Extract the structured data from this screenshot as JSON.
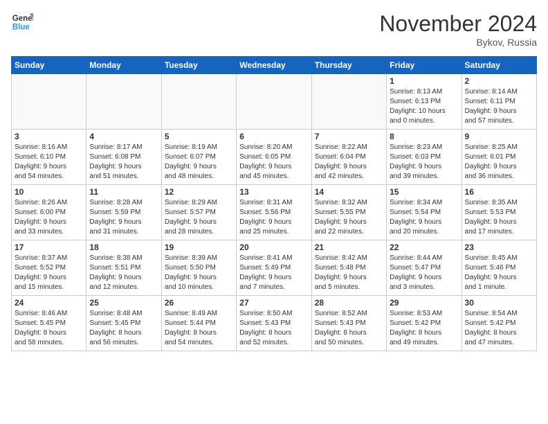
{
  "app": {
    "logo_line1": "General",
    "logo_line2": "Blue"
  },
  "title": "November 2024",
  "location": "Bykov, Russia",
  "days_of_week": [
    "Sunday",
    "Monday",
    "Tuesday",
    "Wednesday",
    "Thursday",
    "Friday",
    "Saturday"
  ],
  "weeks": [
    [
      {
        "day": "",
        "info": ""
      },
      {
        "day": "",
        "info": ""
      },
      {
        "day": "",
        "info": ""
      },
      {
        "day": "",
        "info": ""
      },
      {
        "day": "",
        "info": ""
      },
      {
        "day": "1",
        "info": "Sunrise: 8:13 AM\nSunset: 6:13 PM\nDaylight: 10 hours\nand 0 minutes."
      },
      {
        "day": "2",
        "info": "Sunrise: 8:14 AM\nSunset: 6:11 PM\nDaylight: 9 hours\nand 57 minutes."
      }
    ],
    [
      {
        "day": "3",
        "info": "Sunrise: 8:16 AM\nSunset: 6:10 PM\nDaylight: 9 hours\nand 54 minutes."
      },
      {
        "day": "4",
        "info": "Sunrise: 8:17 AM\nSunset: 6:08 PM\nDaylight: 9 hours\nand 51 minutes."
      },
      {
        "day": "5",
        "info": "Sunrise: 8:19 AM\nSunset: 6:07 PM\nDaylight: 9 hours\nand 48 minutes."
      },
      {
        "day": "6",
        "info": "Sunrise: 8:20 AM\nSunset: 6:05 PM\nDaylight: 9 hours\nand 45 minutes."
      },
      {
        "day": "7",
        "info": "Sunrise: 8:22 AM\nSunset: 6:04 PM\nDaylight: 9 hours\nand 42 minutes."
      },
      {
        "day": "8",
        "info": "Sunrise: 8:23 AM\nSunset: 6:03 PM\nDaylight: 9 hours\nand 39 minutes."
      },
      {
        "day": "9",
        "info": "Sunrise: 8:25 AM\nSunset: 6:01 PM\nDaylight: 9 hours\nand 36 minutes."
      }
    ],
    [
      {
        "day": "10",
        "info": "Sunrise: 8:26 AM\nSunset: 6:00 PM\nDaylight: 9 hours\nand 33 minutes."
      },
      {
        "day": "11",
        "info": "Sunrise: 8:28 AM\nSunset: 5:59 PM\nDaylight: 9 hours\nand 31 minutes."
      },
      {
        "day": "12",
        "info": "Sunrise: 8:29 AM\nSunset: 5:57 PM\nDaylight: 9 hours\nand 28 minutes."
      },
      {
        "day": "13",
        "info": "Sunrise: 8:31 AM\nSunset: 5:56 PM\nDaylight: 9 hours\nand 25 minutes."
      },
      {
        "day": "14",
        "info": "Sunrise: 8:32 AM\nSunset: 5:55 PM\nDaylight: 9 hours\nand 22 minutes."
      },
      {
        "day": "15",
        "info": "Sunrise: 8:34 AM\nSunset: 5:54 PM\nDaylight: 9 hours\nand 20 minutes."
      },
      {
        "day": "16",
        "info": "Sunrise: 8:35 AM\nSunset: 5:53 PM\nDaylight: 9 hours\nand 17 minutes."
      }
    ],
    [
      {
        "day": "17",
        "info": "Sunrise: 8:37 AM\nSunset: 5:52 PM\nDaylight: 9 hours\nand 15 minutes."
      },
      {
        "day": "18",
        "info": "Sunrise: 8:38 AM\nSunset: 5:51 PM\nDaylight: 9 hours\nand 12 minutes."
      },
      {
        "day": "19",
        "info": "Sunrise: 8:39 AM\nSunset: 5:50 PM\nDaylight: 9 hours\nand 10 minutes."
      },
      {
        "day": "20",
        "info": "Sunrise: 8:41 AM\nSunset: 5:49 PM\nDaylight: 9 hours\nand 7 minutes."
      },
      {
        "day": "21",
        "info": "Sunrise: 8:42 AM\nSunset: 5:48 PM\nDaylight: 9 hours\nand 5 minutes."
      },
      {
        "day": "22",
        "info": "Sunrise: 8:44 AM\nSunset: 5:47 PM\nDaylight: 9 hours\nand 3 minutes."
      },
      {
        "day": "23",
        "info": "Sunrise: 8:45 AM\nSunset: 5:46 PM\nDaylight: 9 hours\nand 1 minute."
      }
    ],
    [
      {
        "day": "24",
        "info": "Sunrise: 8:46 AM\nSunset: 5:45 PM\nDaylight: 8 hours\nand 58 minutes."
      },
      {
        "day": "25",
        "info": "Sunrise: 8:48 AM\nSunset: 5:45 PM\nDaylight: 8 hours\nand 56 minutes."
      },
      {
        "day": "26",
        "info": "Sunrise: 8:49 AM\nSunset: 5:44 PM\nDaylight: 8 hours\nand 54 minutes."
      },
      {
        "day": "27",
        "info": "Sunrise: 8:50 AM\nSunset: 5:43 PM\nDaylight: 8 hours\nand 52 minutes."
      },
      {
        "day": "28",
        "info": "Sunrise: 8:52 AM\nSunset: 5:43 PM\nDaylight: 8 hours\nand 50 minutes."
      },
      {
        "day": "29",
        "info": "Sunrise: 8:53 AM\nSunset: 5:42 PM\nDaylight: 8 hours\nand 49 minutes."
      },
      {
        "day": "30",
        "info": "Sunrise: 8:54 AM\nSunset: 5:42 PM\nDaylight: 8 hours\nand 47 minutes."
      }
    ]
  ]
}
